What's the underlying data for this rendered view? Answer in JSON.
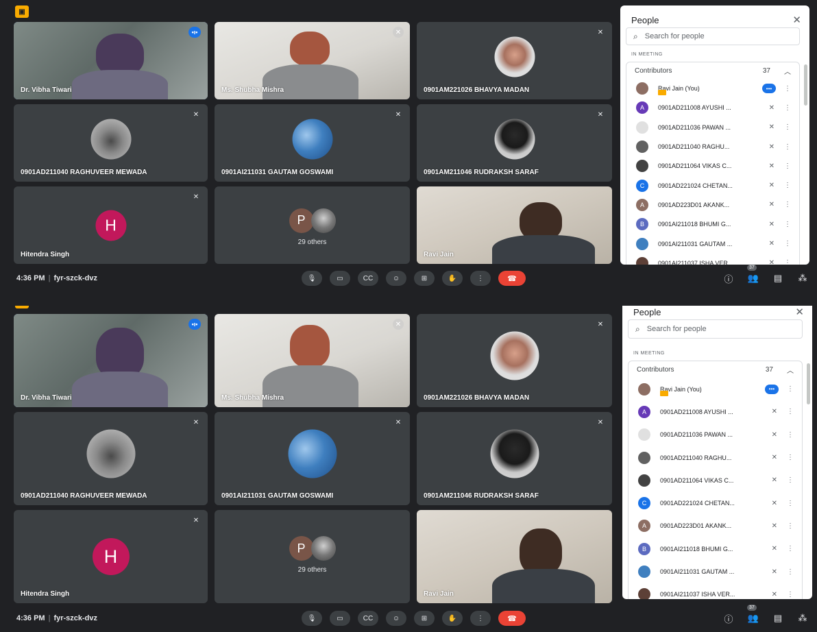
{
  "meeting": {
    "time": "4:36 PM",
    "code": "fyr-szck-dvz",
    "separator": "|",
    "others_label": "29 others",
    "others_initial": "P",
    "people_count": "37"
  },
  "tiles": [
    {
      "name": "Dr. Vibha Tiwari",
      "status": "speaking"
    },
    {
      "name": "Ms. Shubha Mishra",
      "status": "muted"
    },
    {
      "name": "0901AM221026 BHAVYA MADAN",
      "status": "muted"
    },
    {
      "name": "0901AD211040 RAGHUVEER MEWADA",
      "status": "muted"
    },
    {
      "name": "0901AI211031 GAUTAM GOSWAMI",
      "status": "muted"
    },
    {
      "name": "0901AM211046 RUDRAKSH SARAF",
      "status": "muted"
    },
    {
      "name": "Hitendra Singh",
      "status": "muted",
      "initial": "H"
    },
    {
      "name": "",
      "status": "others"
    },
    {
      "name": "Ravi Jain",
      "status": "video"
    }
  ],
  "panel": {
    "title": "People",
    "close_icon": "close-icon",
    "search_placeholder": "Search for people",
    "section_label": "IN MEETING",
    "group_label": "Contributors",
    "group_count": "37",
    "participants": [
      {
        "name": "Ravi Jain (You)",
        "avatar": "photo",
        "color": "#8d6e63"
      },
      {
        "name": "0901AD211008 AYUSHI ...",
        "avatar": "A",
        "color": "#673ab7"
      },
      {
        "name": "0901AD211036 PAWAN ...",
        "avatar": "photo",
        "color": "#e0e0e0"
      },
      {
        "name": "0901AD211040 RAGHU...",
        "avatar": "photo",
        "color": "#616161"
      },
      {
        "name": "0901AD211064 VIKAS C...",
        "avatar": "photo",
        "color": "#424242"
      },
      {
        "name": "0901AD221024 CHETAN...",
        "avatar": "C",
        "color": "#1a73e8"
      },
      {
        "name": "0901AD223D01 AKANK...",
        "avatar": "A",
        "color": "#8d6e63"
      },
      {
        "name": "0901AI211018 BHUMI G...",
        "avatar": "B",
        "color": "#5c6bc0"
      },
      {
        "name": "0901AI211031 GAUTAM ...",
        "avatar": "photo",
        "color": "#3f7fbf"
      },
      {
        "name": "0901AI211037 ISHA VER...",
        "avatar": "photo",
        "color": "#5d4037"
      }
    ]
  },
  "colors": {
    "background": "#202124",
    "tile": "#3c4043",
    "accent": "#1a73e8",
    "end_call": "#ea4335",
    "recording": "#f9ab00",
    "hitendra_avatar": "#c2185b"
  }
}
